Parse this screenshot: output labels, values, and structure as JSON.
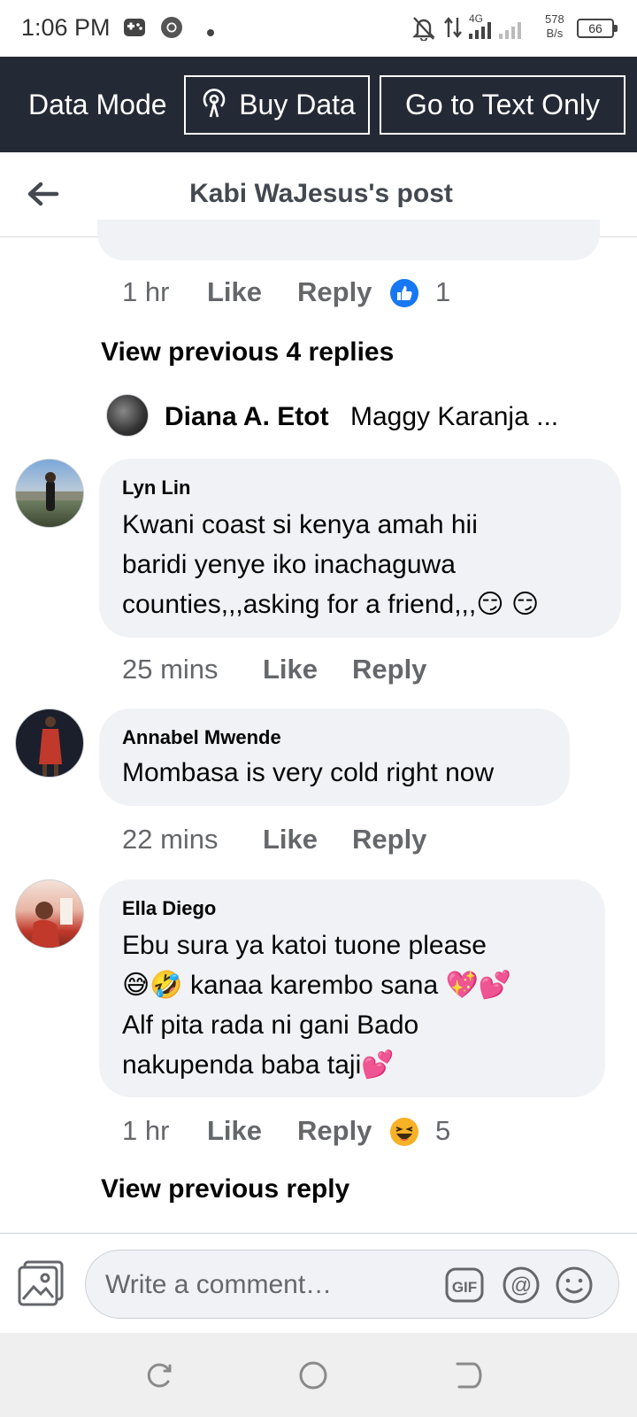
{
  "status_bar": {
    "time": "1:06 PM",
    "network": "4G",
    "net_speed_value": "578",
    "net_speed_unit": "B/s",
    "battery": "66",
    "icons": [
      "gamepad-icon",
      "chrome-icon",
      "dot-icon",
      "mute-bell-icon",
      "data-arrows-icon",
      "signal-icon"
    ]
  },
  "data_bar": {
    "mode_label": "Data Mode",
    "buy_data_label": "Buy Data",
    "text_only_label": "Go to Text Only"
  },
  "header": {
    "title": "Kabi WaJesus's post",
    "back_icon": "back-arrow-icon"
  },
  "top_comment_meta": {
    "time": "1 hr",
    "like": "Like",
    "reply": "Reply",
    "reaction_count": "1",
    "reaction_icon": "like-reaction-icon"
  },
  "view_previous_1": "View previous 4 replies",
  "reply_preview": {
    "author": "Diana A. Etot",
    "snippet": "Maggy Karanja ..."
  },
  "comments": [
    {
      "author": "Lyn Lin",
      "text": "Kwani coast si kenya amah hii\nbaridi yenye iko inachaguwa\ncounties,,,asking for a friend,,,😏 😏",
      "time": "25 mins",
      "like": "Like",
      "reply": "Reply"
    },
    {
      "author": "Annabel Mwende",
      "text": "Mombasa is very cold right now",
      "time": "22 mins",
      "like": "Like",
      "reply": "Reply"
    },
    {
      "author": "Ella Diego",
      "text": "Ebu sura ya katoi tuone please\n😅🤣  kanaa karembo sana 💖💕\nAlf pita rada ni gani  Bado\nnakupenda baba taji💕",
      "time": "1 hr",
      "like": "Like",
      "reply": "Reply",
      "reaction_count": "5",
      "reaction_icon": "haha-reaction-icon"
    }
  ],
  "view_previous_2": "View previous reply",
  "composer": {
    "placeholder": "Write a comment…",
    "icons": [
      "photo-icon",
      "gif-icon",
      "mention-icon",
      "emoji-icon"
    ]
  },
  "nav": {
    "icons": [
      "recent-apps-icon",
      "home-icon",
      "back-icon"
    ]
  },
  "colors": {
    "data_bar_bg": "#242a35",
    "bubble_bg": "#f0f2f5",
    "like_blue": "#1877f2",
    "haha_yellow": "#f7b125"
  }
}
